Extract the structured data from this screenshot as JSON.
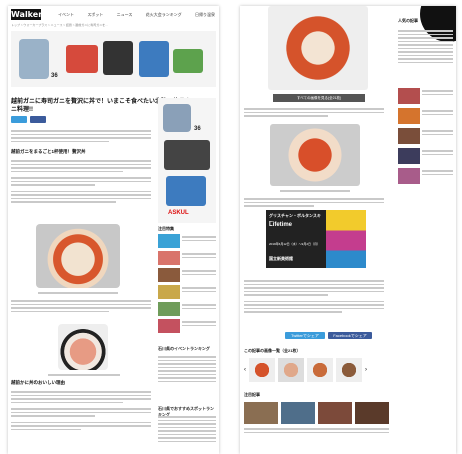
{
  "left_page": {
    "logo": "Walker",
    "nav": [
      "イベント",
      "スポット",
      "ニュース",
      "花火大会ランキング",
      "日帰り温泉"
    ],
    "breadcrumb": "トップ > ウォーカープラス > ニュース > 話題 > 越前ガニに寿司ガニを...",
    "title": "越前ガニに寿司ガニを贅沢に丼で！いまこそ食べたい北陸の絶品カニ料理!!",
    "product_numbers": [
      "36",
      "36"
    ],
    "ad_brand": "ASKUL",
    "section_headings": [
      "越前ガニをまるごと1杯使用！贅沢丼",
      "越前かに丼のおいしい理由"
    ],
    "sidebar_headings": [
      "注目特集",
      "石川県のイベントランキング",
      "石川県でおすすめスポットランキング"
    ]
  },
  "right_page": {
    "button_label": "すべての画像を見る(全21枚)",
    "ad_texts": [
      "グリスチャン・ボルタンスキー",
      "Lifetime",
      "2019年6月12日（水）～9月2日（月）",
      "国立新美術館"
    ],
    "share_twitter": "Twitterでシェア",
    "share_facebook": "Facebookでシェア",
    "related_heading": "この記事の画像一覧（全21枚）",
    "more_heading": "注目記事",
    "sidebar_heading": "人気の記事"
  }
}
